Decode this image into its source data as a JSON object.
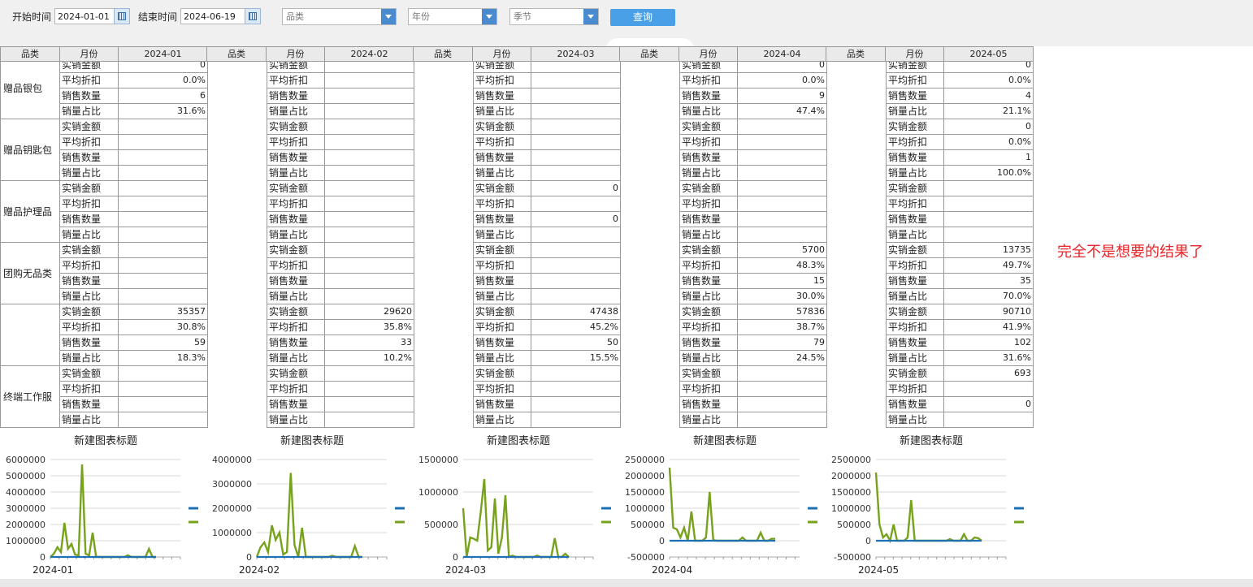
{
  "toolbar": {
    "start_label": "开始时间",
    "start_value": "2024-01-01",
    "end_label": "结束时间",
    "end_value": "2024-06-19",
    "category_placeholder": "品类",
    "year_placeholder": "年份",
    "season_placeholder": "季节",
    "query_label": "查询"
  },
  "table_headers": {
    "category": "品类",
    "month": "月份"
  },
  "metrics": [
    "实销金额",
    "平均折扣",
    "销售数量",
    "销量占比"
  ],
  "categories": [
    "赠品银包",
    "赠品钥匙包",
    "赠品护理品",
    "团购无品类",
    "",
    "终端工作服"
  ],
  "months": [
    {
      "month": "2024-01",
      "values": [
        [
          "0",
          "0.0%",
          "6",
          "31.6%"
        ],
        [
          "",
          "",
          "",
          ""
        ],
        [
          "",
          "",
          "",
          ""
        ],
        [
          "",
          "",
          "",
          ""
        ],
        [
          "35357",
          "30.8%",
          "59",
          "18.3%"
        ],
        [
          "",
          "",
          "",
          ""
        ]
      ]
    },
    {
      "month": "2024-02",
      "values": [
        [
          "",
          "",
          "",
          ""
        ],
        [
          "",
          "",
          "",
          ""
        ],
        [
          "",
          "",
          "",
          ""
        ],
        [
          "",
          "",
          "",
          ""
        ],
        [
          "29620",
          "35.8%",
          "33",
          "10.2%"
        ],
        [
          "",
          "",
          "",
          ""
        ]
      ]
    },
    {
      "month": "2024-03",
      "values": [
        [
          "",
          "",
          "",
          ""
        ],
        [
          "",
          "",
          "",
          ""
        ],
        [
          "0",
          "",
          "0",
          ""
        ],
        [
          "",
          "",
          "",
          ""
        ],
        [
          "47438",
          "45.2%",
          "50",
          "15.5%"
        ],
        [
          "",
          "",
          "",
          ""
        ]
      ]
    },
    {
      "month": "2024-04",
      "values": [
        [
          "0",
          "0.0%",
          "9",
          "47.4%"
        ],
        [
          "",
          "",
          "",
          ""
        ],
        [
          "",
          "",
          "",
          ""
        ],
        [
          "5700",
          "48.3%",
          "15",
          "30.0%"
        ],
        [
          "57836",
          "38.7%",
          "79",
          "24.5%"
        ],
        [
          "",
          "",
          "",
          ""
        ]
      ]
    },
    {
      "month": "2024-05",
      "values": [
        [
          "0",
          "0.0%",
          "4",
          "21.1%"
        ],
        [
          "0",
          "0.0%",
          "1",
          "100.0%"
        ],
        [
          "",
          "",
          "",
          ""
        ],
        [
          "13735",
          "49.7%",
          "35",
          "70.0%"
        ],
        [
          "90710",
          "41.9%",
          "102",
          "31.6%"
        ],
        [
          "693",
          "",
          "0",
          ""
        ]
      ]
    }
  ],
  "annotation": "完全不是想要的结果了",
  "colors": {
    "series_blue": "#1f6fb5",
    "series_green": "#77a21c",
    "query_btn": "#4aa0e6",
    "annotation": "#e8262a"
  },
  "chart_data": [
    {
      "type": "line",
      "title": "新建图表标题",
      "xlabel": "2024-01",
      "ylim": [
        0,
        6000000
      ],
      "yticks": [
        "0",
        "1000000",
        "2000000",
        "3000000",
        "4000000",
        "5000000",
        "6000000"
      ],
      "series": [
        {
          "values": [
            0,
            0,
            0,
            0,
            0,
            0,
            0,
            0,
            0,
            0,
            0,
            0,
            0,
            0,
            0,
            0,
            0,
            0,
            0,
            0,
            0,
            0,
            0,
            0,
            0,
            0,
            0,
            0,
            0,
            0,
            0
          ]
        },
        {
          "values": [
            0,
            200000,
            600000,
            300000,
            2100000,
            500000,
            800000,
            150000,
            100000,
            5700000,
            200000,
            100000,
            1500000,
            0,
            0,
            0,
            0,
            0,
            0,
            0,
            0,
            0,
            100000,
            0,
            0,
            0,
            0,
            0,
            500000,
            0,
            0
          ]
        }
      ]
    },
    {
      "type": "line",
      "title": "新建图表标题",
      "xlabel": "2024-02",
      "ylim": [
        0,
        4000000
      ],
      "yticks": [
        "0",
        "1000000",
        "2000000",
        "3000000",
        "4000000"
      ],
      "series": [
        {
          "values": [
            0,
            0,
            0,
            0,
            0,
            0,
            0,
            0,
            0,
            0,
            0,
            0,
            0,
            0,
            0,
            0,
            0,
            0,
            0,
            0,
            0,
            0,
            0,
            0,
            0,
            0,
            0,
            0,
            0
          ]
        },
        {
          "values": [
            0,
            400000,
            600000,
            200000,
            1300000,
            700000,
            1000000,
            100000,
            200000,
            3450000,
            500000,
            0,
            1200000,
            0,
            0,
            0,
            0,
            0,
            0,
            0,
            50000,
            0,
            0,
            0,
            0,
            0,
            450000,
            0,
            0
          ]
        }
      ]
    },
    {
      "type": "line",
      "title": "新建图表标题",
      "xlabel": "2024-03",
      "ylim": [
        0,
        1500000
      ],
      "yticks": [
        "0",
        "500000",
        "1000000",
        "1500000"
      ],
      "series": [
        {
          "values": [
            0,
            0,
            0,
            0,
            0,
            0,
            0,
            0,
            0,
            0,
            0,
            0,
            0,
            0,
            0,
            0,
            0,
            0,
            0,
            0,
            0,
            0,
            0,
            0,
            0,
            0,
            0,
            0,
            0,
            0,
            0
          ]
        },
        {
          "values": [
            750000,
            0,
            300000,
            280000,
            250000,
            700000,
            1200000,
            100000,
            150000,
            900000,
            50000,
            300000,
            950000,
            0,
            20000,
            0,
            0,
            0,
            0,
            0,
            0,
            20000,
            0,
            0,
            0,
            0,
            290000,
            0,
            0,
            50000,
            0
          ]
        }
      ]
    },
    {
      "type": "line",
      "title": "新建图表标题",
      "xlabel": "2024-04",
      "ylim": [
        -500000,
        2500000
      ],
      "yticks": [
        "-500000",
        "0",
        "500000",
        "1000000",
        "1500000",
        "2000000",
        "2500000"
      ],
      "series": [
        {
          "values": [
            0,
            0,
            0,
            0,
            0,
            0,
            0,
            0,
            0,
            0,
            0,
            0,
            0,
            0,
            0,
            0,
            0,
            0,
            0,
            0,
            0,
            0,
            0,
            0,
            0,
            0,
            0,
            0,
            0,
            0
          ]
        },
        {
          "values": [
            2250000,
            400000,
            350000,
            100000,
            400000,
            0,
            900000,
            0,
            0,
            0,
            100000,
            1500000,
            20000,
            0,
            0,
            0,
            0,
            0,
            0,
            0,
            100000,
            0,
            0,
            0,
            0,
            250000,
            0,
            0,
            60000,
            60000
          ]
        }
      ]
    },
    {
      "type": "line",
      "title": "新建图表标题",
      "xlabel": "2024-05",
      "ylim": [
        -500000,
        2500000
      ],
      "yticks": [
        "-500000",
        "0",
        "500000",
        "1000000",
        "1500000",
        "2000000",
        "2500000"
      ],
      "series": [
        {
          "values": [
            0,
            0,
            0,
            0,
            0,
            0,
            0,
            0,
            0,
            0,
            0,
            0,
            0,
            0,
            0,
            0,
            0,
            0,
            0,
            0,
            0,
            0,
            0,
            0,
            0,
            0,
            0,
            0,
            0,
            0,
            0
          ]
        },
        {
          "values": [
            2100000,
            500000,
            100000,
            200000,
            0,
            500000,
            0,
            0,
            0,
            100000,
            1250000,
            0,
            0,
            0,
            0,
            0,
            0,
            0,
            0,
            0,
            0,
            50000,
            0,
            0,
            0,
            200000,
            0,
            0,
            100000,
            80000,
            0
          ]
        }
      ]
    }
  ]
}
